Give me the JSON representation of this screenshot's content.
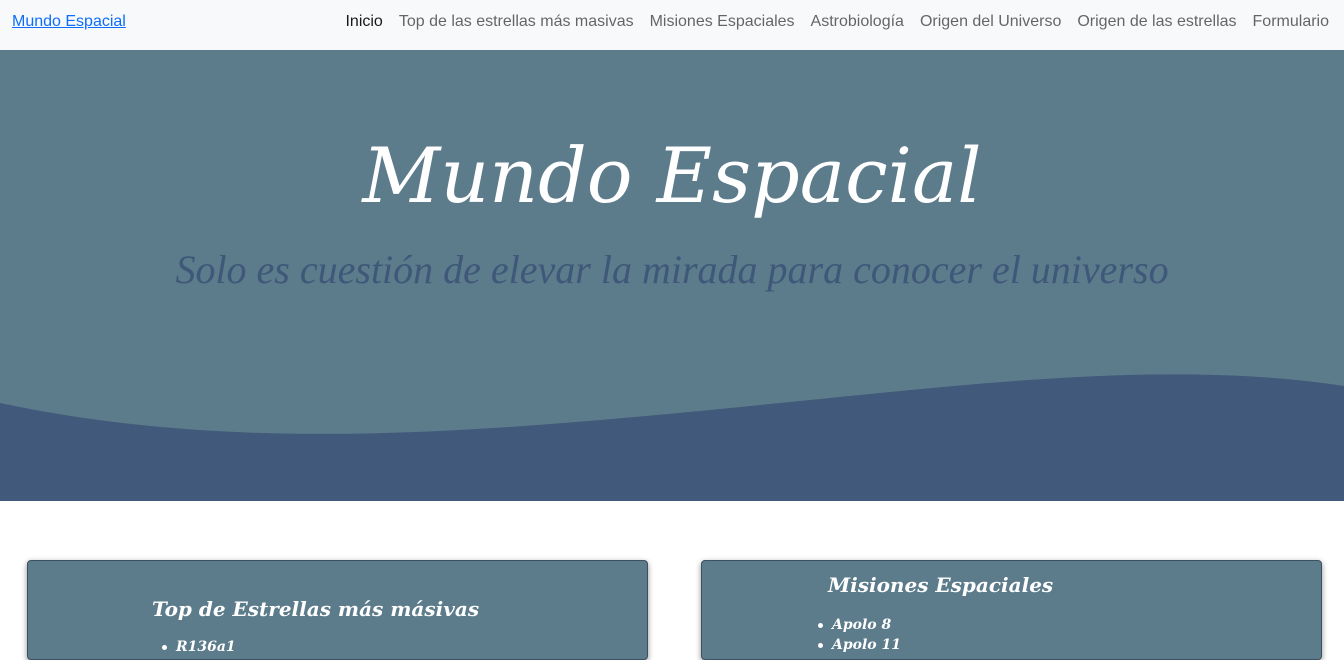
{
  "navbar": {
    "brand": "Mundo Espacial",
    "links": [
      {
        "label": "Inicio",
        "active": true
      },
      {
        "label": "Top de las estrellas más masivas",
        "active": false
      },
      {
        "label": "Misiones Espaciales",
        "active": false
      },
      {
        "label": "Astrobiología",
        "active": false
      },
      {
        "label": "Origen del Universo",
        "active": false
      },
      {
        "label": "Origen de las estrellas",
        "active": false
      },
      {
        "label": "Formulario",
        "active": false
      }
    ]
  },
  "hero": {
    "title": "Mundo Espacial",
    "subtitle": "Solo es cuestión de elevar la mirada para conocer el universo"
  },
  "cards": {
    "left": {
      "title": "Top de Estrellas más másivas",
      "items": [
        "R136a1"
      ]
    },
    "right": {
      "title": "Misiones Espaciales",
      "items": [
        "Apolo 8",
        "Apolo 11"
      ]
    }
  },
  "colors": {
    "hero_bg": "#5c7b8b",
    "wave": "#41597a",
    "subtitle": "#3f5779",
    "navbar_bg": "#f8f9fa",
    "brand_link": "#0d6efd"
  }
}
